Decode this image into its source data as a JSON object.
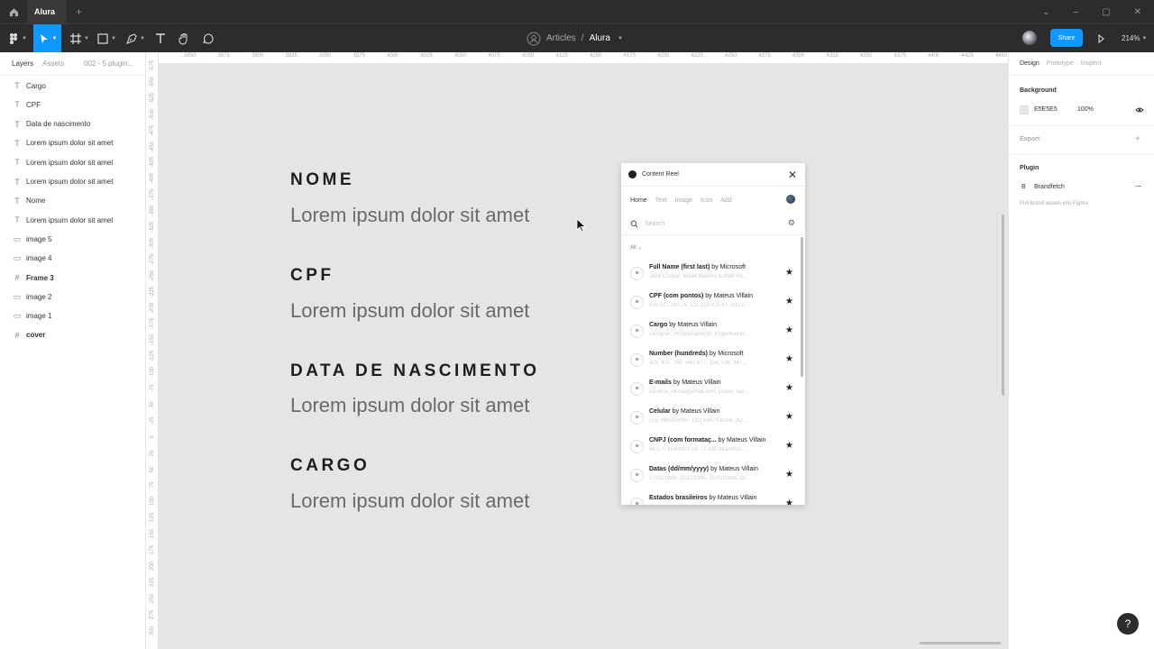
{
  "tabs": {
    "file_tab": "Alura",
    "new_tab": "+"
  },
  "toolbar": {
    "breadcrumb_project": "Articles",
    "breadcrumb_sep": "/",
    "breadcrumb_file": "Alura",
    "share_label": "Share",
    "zoom": "214%"
  },
  "left_panel": {
    "tab_layers": "Layers",
    "tab_assets": "Assets",
    "page_select": "002 - 5 plugin...",
    "layers": [
      {
        "icon": "T",
        "label": "Cargo"
      },
      {
        "icon": "T",
        "label": "CPF"
      },
      {
        "icon": "T",
        "label": "Data de nascimento"
      },
      {
        "icon": "T",
        "label": "Lorem ipsum dolor sit amet"
      },
      {
        "icon": "T",
        "label": "Lorem ipsum dolor sit amet"
      },
      {
        "icon": "T",
        "label": "Lorem ipsum dolor sit amet"
      },
      {
        "icon": "T",
        "label": "Nome"
      },
      {
        "icon": "T",
        "label": "Lorem ipsum dolor sit amet"
      },
      {
        "icon": "▭",
        "label": "image 5"
      },
      {
        "icon": "▭",
        "label": "image 4"
      },
      {
        "icon": "#",
        "label": "Frame 3"
      },
      {
        "icon": "▭",
        "label": "image 2"
      },
      {
        "icon": "▭",
        "label": "image 1"
      },
      {
        "icon": "#",
        "label": "cover"
      }
    ]
  },
  "rulers": {
    "top": [
      "3850",
      "3875",
      "3900",
      "3925",
      "3950",
      "3975",
      "4000",
      "4025",
      "4050",
      "4075",
      "4100",
      "4125",
      "4150",
      "4175",
      "4200",
      "4225",
      "4250",
      "4275",
      "4300",
      "4325",
      "4350",
      "4375",
      "4400",
      "4425",
      "4450",
      "4475"
    ],
    "left": [
      "-575",
      "-550",
      "-525",
      "-500",
      "-475",
      "-450",
      "-425",
      "-400",
      "-375",
      "-350",
      "-325",
      "-300",
      "-275",
      "-250",
      "-225",
      "-200",
      "-175",
      "-150",
      "-125",
      "-100",
      "-75",
      "-50",
      "-25",
      "0",
      "25",
      "50",
      "75",
      "100",
      "125",
      "150",
      "175",
      "200",
      "225",
      "250",
      "275",
      "300"
    ]
  },
  "canvas": {
    "fields": [
      {
        "label": "NOME",
        "value": "Lorem ipsum dolor sit amet"
      },
      {
        "label": "CPF",
        "value": "Lorem ipsum dolor sit amet"
      },
      {
        "label": "DATA DE NASCIMENTO",
        "value": "Lorem ipsum dolor sit amet"
      },
      {
        "label": "CARGO",
        "value": "Lorem ipsum dolor sit amet"
      }
    ]
  },
  "plugin": {
    "title": "Content Reel",
    "nav": [
      "Home",
      "Text",
      "Image",
      "Icon",
      "Add"
    ],
    "search_placeholder": "Search",
    "filter": "All ⌄",
    "items": [
      {
        "name": "Full Name (first last)",
        "by": "by Microsoft",
        "sub": "Jane Cooper, Wade Warren, Esther Ho..."
      },
      {
        "name": "CPF (com pontos)",
        "by": "by Mateus Villain",
        "sub": "530.517.260-79, 225.315.020-67, 832.0..."
      },
      {
        "name": "Cargo",
        "by": "by Mateus Villain",
        "sub": "Designer, Programador(a), Engenheiro(..."
      },
      {
        "name": "Number (hundreds)",
        "by": "by Microsoft",
        "sub": "429, 402, 798, 540, 877, 154, 536, 447,..."
      },
      {
        "name": "E-mails",
        "by": "by Mateus Villain",
        "sub": "carolina_nilima@email.com, yvane_say..."
      },
      {
        "name": "Celular",
        "by": "by Mateus Villain",
        "sub": "(15) 99650-8087, (32) 63473-8264, (42..."
      },
      {
        "name": "CNPJ (com formataç...",
        "by": "by Mateus Villain",
        "sub": "40.570.454/0001-06, 71.030.861/0001-..."
      },
      {
        "name": "Datas (dd/mm/yyyy)",
        "by": "by Mateus Villain",
        "sub": "17/01/1984, 31/12/1985, 01/01/1988, 28..."
      },
      {
        "name": "Estados brasileiros",
        "by": "by Mateus Villain",
        "sub": ""
      }
    ]
  },
  "right_panel": {
    "tabs": [
      "Design",
      "Prototype",
      "Inspect"
    ],
    "background_title": "Background",
    "bg_hex": "E5E5E5",
    "bg_opacity": "100%",
    "export_title": "Export",
    "export_add": "+",
    "plugin_title": "Plugin",
    "plugin_name": "Brandfetch",
    "plugin_desc": "Pull brand assets into Figma",
    "plugin_remove": "—"
  },
  "help": "?",
  "colors": {
    "accent": "#0d99ff",
    "canvas_bg": "#e5e5e5",
    "chrome": "#2c2c2c"
  }
}
